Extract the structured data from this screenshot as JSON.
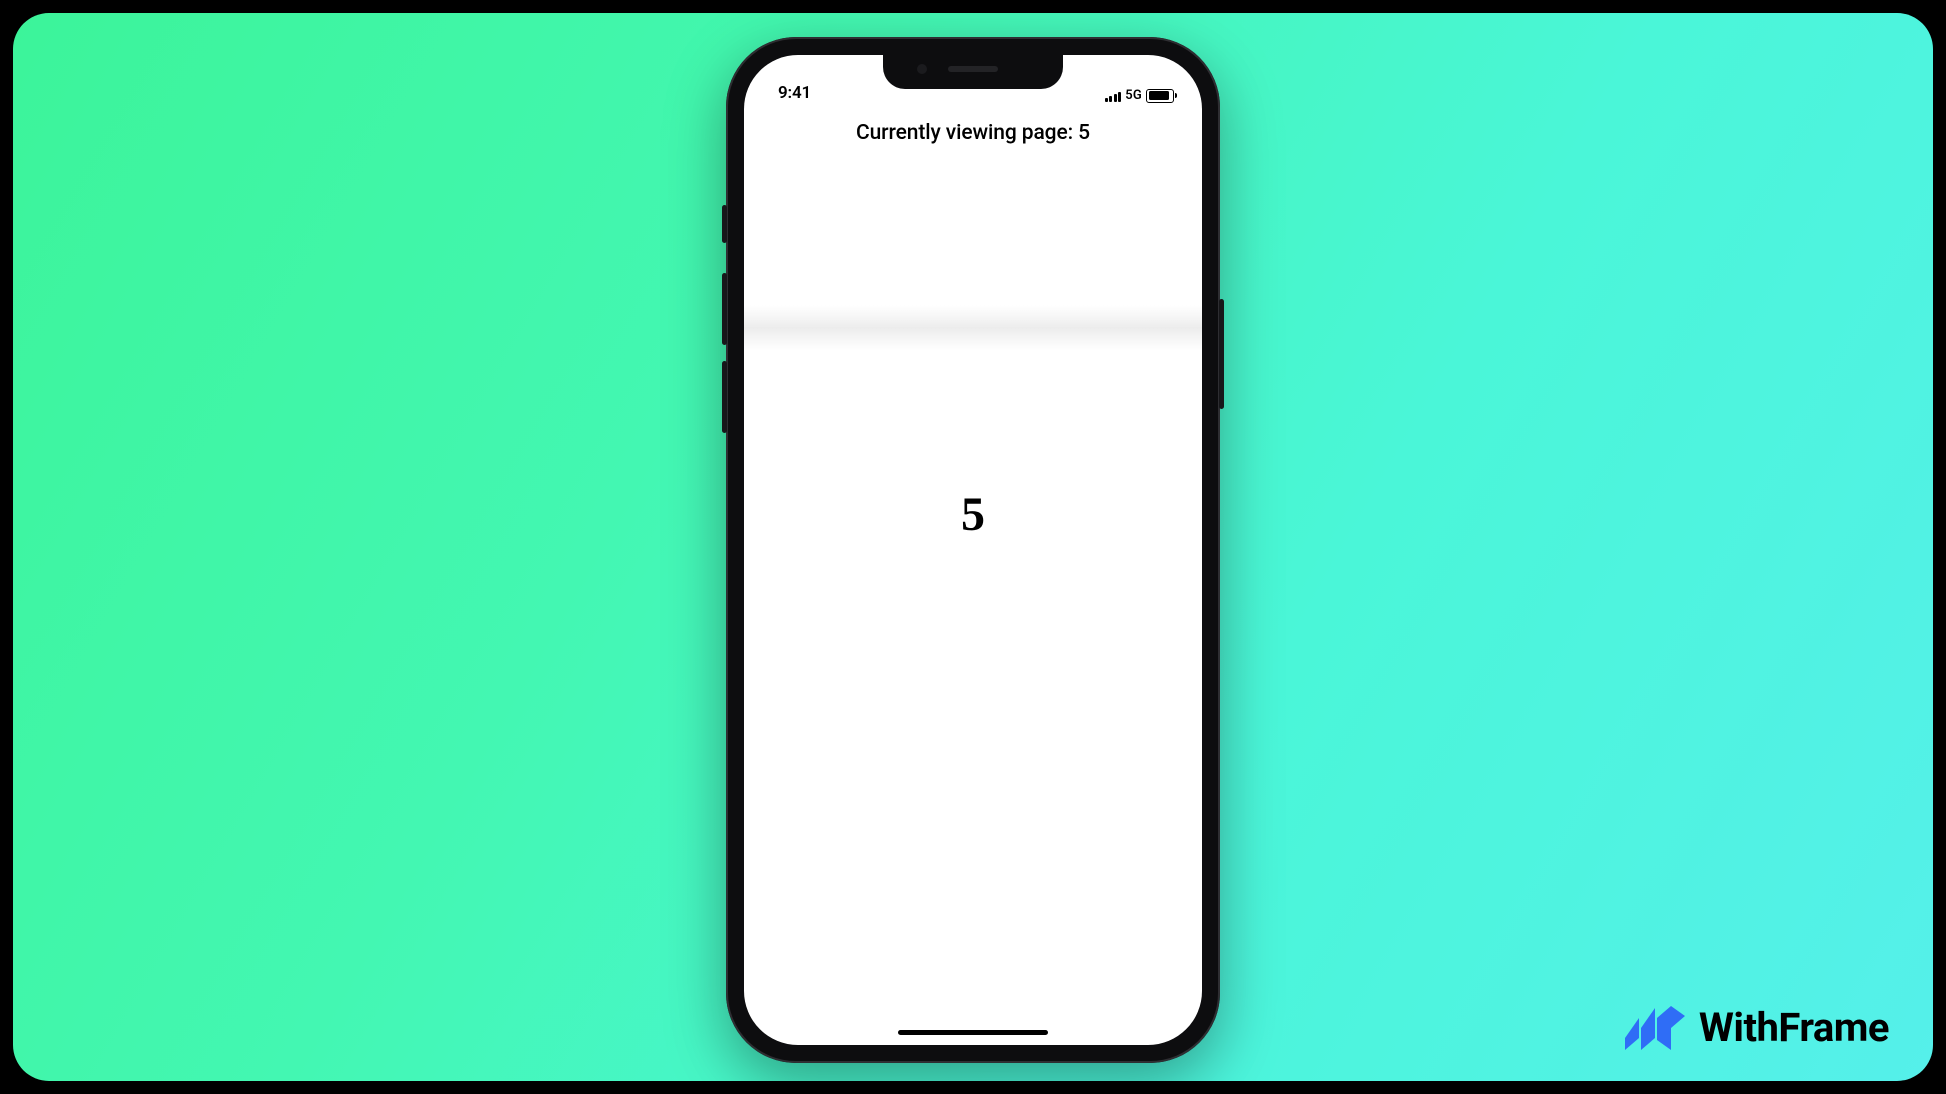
{
  "statusbar": {
    "time": "9:41",
    "network_type": "5G"
  },
  "app": {
    "title": "Currently viewing page: 5",
    "page_number": "5"
  },
  "brand": {
    "name": "WithFrame",
    "logo_color": "#2f6df6"
  }
}
